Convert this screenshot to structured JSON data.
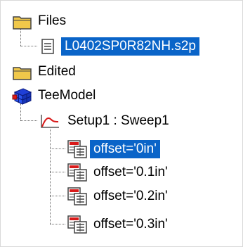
{
  "tree": {
    "files": {
      "label": "Files",
      "child": {
        "label": "L0402SP0R82NH.s2p",
        "selected": true
      }
    },
    "edited": {
      "label": "Edited"
    },
    "model": {
      "label": "TeeModel",
      "setup": {
        "label": "Setup1 : Sweep1",
        "items": [
          {
            "label": "offset='0in'",
            "selected": true
          },
          {
            "label": "offset='0.1in'",
            "selected": false
          },
          {
            "label": "offset='0.2in'",
            "selected": false
          },
          {
            "label": "offset='0.3in'",
            "selected": false
          }
        ]
      }
    }
  },
  "colors": {
    "selection": "#0a64c8",
    "folder": "#f0c84a",
    "model_blue": "#1f3fd6",
    "model_red": "#e01818",
    "curve_red": "#d81a1a"
  }
}
